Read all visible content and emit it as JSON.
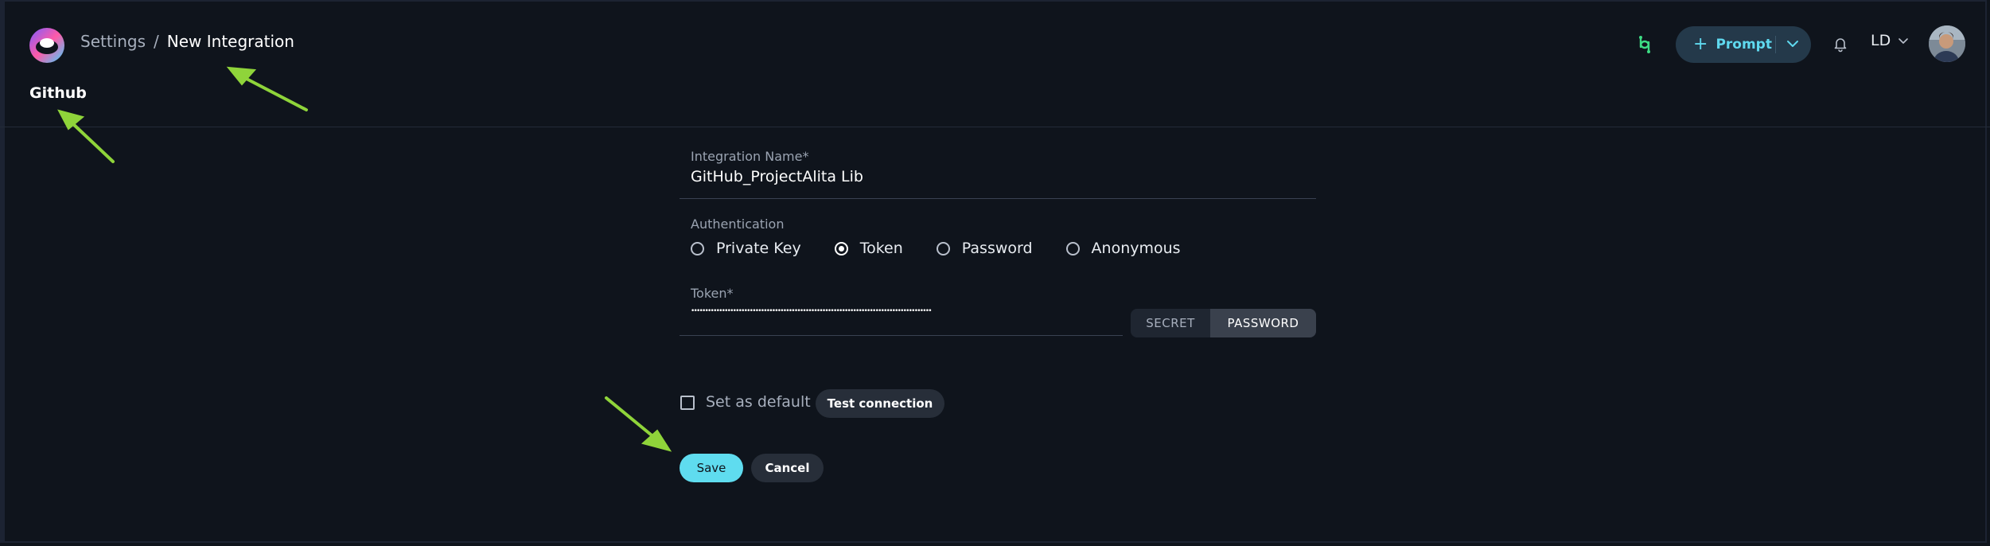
{
  "breadcrumb": {
    "parent": "Settings",
    "separator": "/",
    "current": "New Integration"
  },
  "page_title": "Github",
  "header": {
    "prompt_button": {
      "plus": "+",
      "label": "Prompt"
    },
    "user_initials": "LD"
  },
  "form": {
    "integration_name": {
      "label": "Integration Name*",
      "value": "GitHub_ProjectAlita Lib"
    },
    "authentication": {
      "label": "Authentication",
      "options": [
        "Private Key",
        "Token",
        "Password",
        "Anonymous"
      ],
      "selected": "Token"
    },
    "token": {
      "label": "Token*",
      "masked_value": "••••••••••••••••••••••••••••••••••••••••••••••••••••••••••••••••••••••••••••••••••••••",
      "toggle_options": [
        "SECRET",
        "PASSWORD"
      ],
      "toggle_selected": "PASSWORD"
    },
    "set_default": {
      "label": "Set as default",
      "checked": false
    },
    "test_connection_label": "Test connection",
    "save_label": "Save",
    "cancel_label": "Cancel"
  },
  "colors": {
    "background": "#0f141c",
    "accent": "#5fdcef",
    "annotation_arrow": "#8fd43a"
  },
  "icons": [
    "app-logo-icon",
    "integrations-icon",
    "chevron-down-icon",
    "bell-icon",
    "user-avatar"
  ]
}
